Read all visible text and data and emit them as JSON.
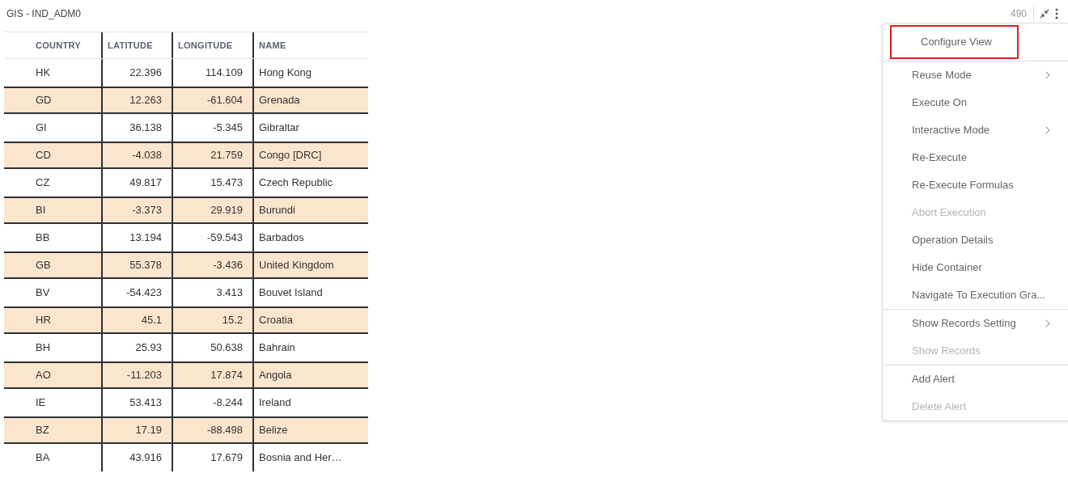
{
  "panel": {
    "title": "GIS - IND_ADM0",
    "record_count": "490"
  },
  "table": {
    "columns": [
      "COUNTRY",
      "LATITUDE",
      "LONGITUDE",
      "NAME"
    ],
    "rows": [
      {
        "cells": [
          "HK",
          "22.396",
          "114.109",
          "Hong Kong"
        ],
        "highlighted": false
      },
      {
        "cells": [
          "GD",
          "12.263",
          "-61.604",
          "Grenada"
        ],
        "highlighted": true
      },
      {
        "cells": [
          "GI",
          "36.138",
          "-5.345",
          "Gibraltar"
        ],
        "highlighted": false
      },
      {
        "cells": [
          "CD",
          "-4.038",
          "21.759",
          "Congo [DRC]"
        ],
        "highlighted": true
      },
      {
        "cells": [
          "CZ",
          "49.817",
          "15.473",
          "Czech Republic"
        ],
        "highlighted": false
      },
      {
        "cells": [
          "BI",
          "-3.373",
          "29.919",
          "Burundi"
        ],
        "highlighted": true
      },
      {
        "cells": [
          "BB",
          "13.194",
          "-59.543",
          "Barbados"
        ],
        "highlighted": false
      },
      {
        "cells": [
          "GB",
          "55.378",
          "-3.436",
          "United Kingdom"
        ],
        "highlighted": true
      },
      {
        "cells": [
          "BV",
          "-54.423",
          "3.413",
          "Bouvet Island"
        ],
        "highlighted": false
      },
      {
        "cells": [
          "HR",
          "45.1",
          "15.2",
          "Croatia"
        ],
        "highlighted": true
      },
      {
        "cells": [
          "BH",
          "25.93",
          "50.638",
          "Bahrain"
        ],
        "highlighted": false
      },
      {
        "cells": [
          "AO",
          "-11.203",
          "17.874",
          "Angola"
        ],
        "highlighted": true
      },
      {
        "cells": [
          "IE",
          "53.413",
          "-8.244",
          "Ireland"
        ],
        "highlighted": false
      },
      {
        "cells": [
          "BZ",
          "17.19",
          "-88.498",
          "Belize"
        ],
        "highlighted": true
      },
      {
        "cells": [
          "BA",
          "43.916",
          "17.679",
          "Bosnia and Her…"
        ],
        "highlighted": false
      }
    ]
  },
  "menu": {
    "groups": [
      [
        {
          "label": "Configure View",
          "selected": true,
          "disabled": false,
          "submenu": false
        }
      ],
      [
        {
          "label": "Reuse Mode",
          "selected": false,
          "disabled": false,
          "submenu": true
        },
        {
          "label": "Execute On",
          "selected": false,
          "disabled": false,
          "submenu": false
        },
        {
          "label": "Interactive Mode",
          "selected": false,
          "disabled": false,
          "submenu": true
        },
        {
          "label": "Re-Execute",
          "selected": false,
          "disabled": false,
          "submenu": false
        },
        {
          "label": "Re-Execute Formulas",
          "selected": false,
          "disabled": false,
          "submenu": false
        },
        {
          "label": "Abort Execution",
          "selected": false,
          "disabled": true,
          "submenu": false
        },
        {
          "label": "Operation Details",
          "selected": false,
          "disabled": false,
          "submenu": false
        },
        {
          "label": "Hide Container",
          "selected": false,
          "disabled": false,
          "submenu": false
        },
        {
          "label": "Navigate To Execution Gra...",
          "selected": false,
          "disabled": false,
          "submenu": false
        }
      ],
      [
        {
          "label": "Show Records Setting",
          "selected": false,
          "disabled": false,
          "submenu": true
        },
        {
          "label": "Show Records",
          "selected": false,
          "disabled": true,
          "submenu": false
        }
      ],
      [
        {
          "label": "Add Alert",
          "selected": false,
          "disabled": false,
          "submenu": false
        },
        {
          "label": "Delete Alert",
          "selected": false,
          "disabled": true,
          "submenu": false
        }
      ]
    ]
  }
}
